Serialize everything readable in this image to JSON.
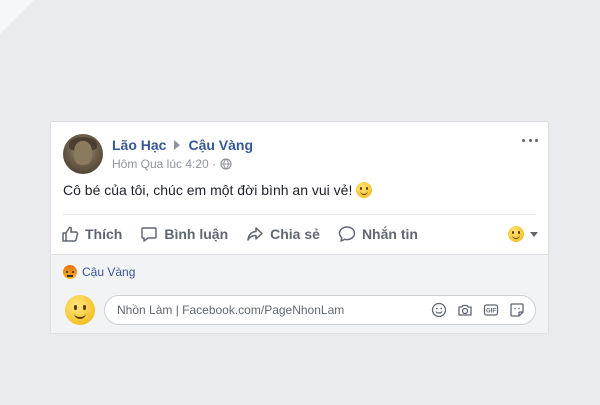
{
  "post": {
    "author": "Lão Hạc",
    "target": "Cậu Vàng",
    "timestamp": "Hôm Qua lúc 4:20 ·",
    "text": "Cô bé của tôi, chúc em một đời bình an vui vẻ!"
  },
  "actions": {
    "like": "Thích",
    "comment": "Bình luận",
    "share": "Chia sẻ",
    "message": "Nhắn tin"
  },
  "reactions": {
    "name": "Cậu Vàng"
  },
  "comment": {
    "placeholder": "Nhồn Làm | Facebook.com/PageNhonLam"
  },
  "colors": {
    "link": "#365899",
    "muted": "#606770",
    "background": "#e9ebee"
  },
  "icons": [
    "globe-icon",
    "more-icon",
    "like-icon",
    "comment-icon",
    "share-icon",
    "message-icon",
    "emoji-icon",
    "camera-icon",
    "gif-icon",
    "sticker-icon"
  ]
}
